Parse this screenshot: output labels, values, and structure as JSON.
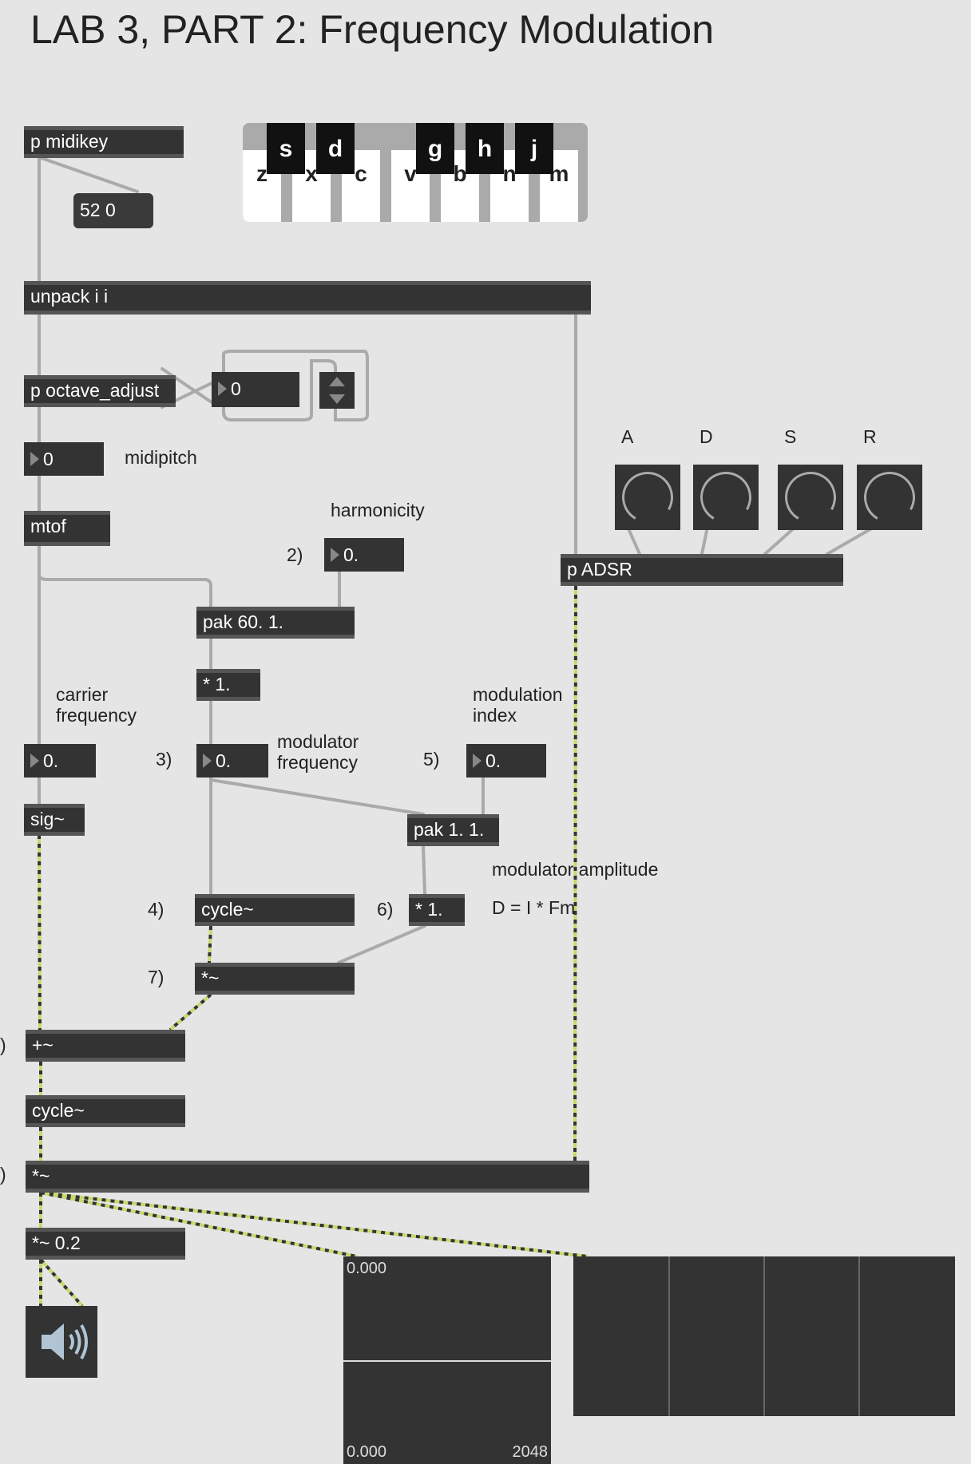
{
  "title": "LAB 3, PART 2: Frequency Modulation",
  "keyboard": {
    "white_keys": [
      "z",
      "x",
      "c",
      "v",
      "b",
      "n",
      "m"
    ],
    "black_keys": [
      "s",
      "d",
      "g",
      "h",
      "j"
    ]
  },
  "objects": {
    "midikey": "p midikey",
    "unpack": "unpack i i",
    "octave": "p octave_adjust",
    "mtof": "mtof",
    "adsr": "p ADSR",
    "pak1": "pak 60. 1.",
    "mul1": "* 1.",
    "sig": "sig~",
    "pak2": "pak 1. 1.",
    "cycle1": "cycle~",
    "mul2": "* 1.",
    "sigmul1": "*~",
    "plus": "+~",
    "cycle2": "cycle~",
    "sigmul2": "*~",
    "gain": "*~ 0.2"
  },
  "messages": {
    "note": "52 0"
  },
  "numbers": {
    "octave_val": "0",
    "midipitch_val": "0",
    "harmonicity_val": "0.",
    "carrier_val": "0.",
    "modfreq_val": "0.",
    "modindex_val": "0."
  },
  "comments": {
    "midipitch": "midipitch",
    "harmonicity": "harmonicity",
    "step2": "2)",
    "carrier": "carrier\nfrequency",
    "step3": "3)",
    "modfreq": "modulator\nfrequency",
    "modindex": "modulation\nindex",
    "step5": "5)",
    "modamp": "modulator amplitude",
    "formula": "D = I * Fm",
    "step4": "4)",
    "step6": "6)",
    "step7": "7)",
    "cut1": ")",
    "cut2": ")",
    "A": "A",
    "D": "D",
    "S": "S",
    "R": "R"
  },
  "scope": {
    "top_value": "0.000",
    "bottom_value": "0.000",
    "range": "2048"
  },
  "icons": [
    "speaker-icon",
    "dial-icon",
    "up-down-arrows-icon"
  ],
  "colors": {
    "background": "#e5e5e5",
    "object": "#333333",
    "signal_cord": "#c9d86a",
    "control_cord": "#aaaaaa"
  }
}
